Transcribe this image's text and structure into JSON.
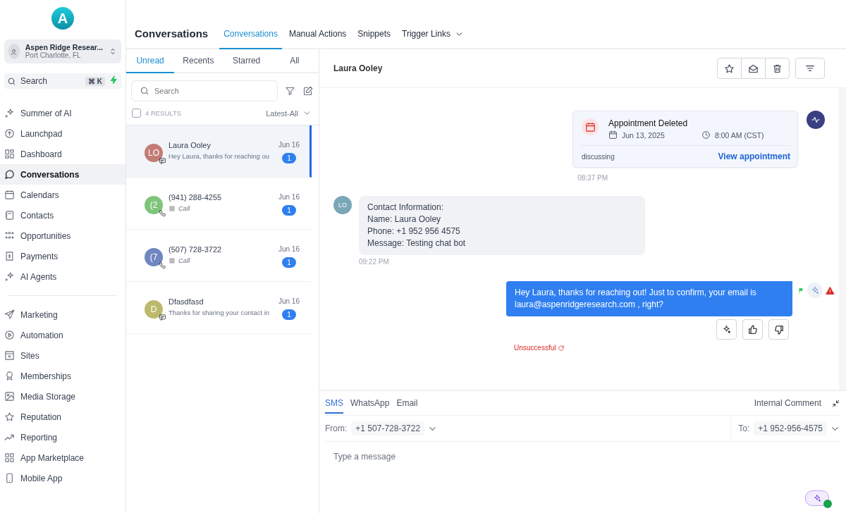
{
  "sidebar": {
    "logo": "A",
    "account": {
      "name": "Aspen Ridge Resear...",
      "location": "Port Charlotte, FL"
    },
    "search": {
      "placeholder": "Search",
      "shortcut": "⌘ K"
    },
    "nav_groups": [
      [
        {
          "label": "Summer of AI",
          "selected": false
        },
        {
          "label": "Launchpad",
          "selected": false
        },
        {
          "label": "Dashboard",
          "selected": false
        },
        {
          "label": "Conversations",
          "selected": true
        },
        {
          "label": "Calendars",
          "selected": false
        },
        {
          "label": "Contacts",
          "selected": false
        },
        {
          "label": "Opportunities",
          "selected": false
        },
        {
          "label": "Payments",
          "selected": false
        },
        {
          "label": "AI Agents",
          "selected": false
        }
      ],
      [
        {
          "label": "Marketing",
          "selected": false
        },
        {
          "label": "Automation",
          "selected": false
        },
        {
          "label": "Sites",
          "selected": false
        },
        {
          "label": "Memberships",
          "selected": false
        },
        {
          "label": "Media Storage",
          "selected": false
        },
        {
          "label": "Reputation",
          "selected": false
        },
        {
          "label": "Reporting",
          "selected": false
        },
        {
          "label": "App Marketplace",
          "selected": false
        },
        {
          "label": "Mobile App",
          "selected": false
        }
      ]
    ]
  },
  "header": {
    "title": "Conversations",
    "tabs": [
      {
        "label": "Conversations",
        "selected": true,
        "dropdown": false
      },
      {
        "label": "Manual Actions",
        "selected": false,
        "dropdown": false
      },
      {
        "label": "Snippets",
        "selected": false,
        "dropdown": false
      },
      {
        "label": "Trigger Links",
        "selected": false,
        "dropdown": true
      }
    ]
  },
  "list": {
    "tabs": [
      {
        "label": "Unread",
        "selected": true
      },
      {
        "label": "Recents",
        "selected": false
      },
      {
        "label": "Starred",
        "selected": false
      },
      {
        "label": "All",
        "selected": false
      }
    ],
    "search": {
      "placeholder": "Search"
    },
    "results": "4 RESULTS",
    "select_all_checked": false,
    "sort": "Latest-All",
    "conversations": [
      {
        "initials": "LO",
        "color": "#c27c74",
        "kind": "sms",
        "name": "Laura Ooley",
        "preview": "Hey Laura, thanks for reaching ou",
        "date": "Jun 16",
        "unread": "1",
        "selected": true
      },
      {
        "initials": "(2",
        "color": "#7fc47a",
        "kind": "call",
        "name": "(941) 288-4255",
        "preview": "Call",
        "date": "Jun 16",
        "unread": "1",
        "selected": false
      },
      {
        "initials": "(7",
        "color": "#6f86c0",
        "kind": "call",
        "name": "(507) 728-3722",
        "preview": "Call",
        "date": "Jun 16",
        "unread": "1",
        "selected": false
      },
      {
        "initials": "D",
        "color": "#bdb96c",
        "kind": "sms",
        "name": "Dfasdfasd",
        "preview": "Thanks for sharing your contact in",
        "date": "Jun 16",
        "unread": "1",
        "selected": false
      }
    ]
  },
  "chat": {
    "contact": "Laura Ooley",
    "messages": [
      {
        "kind": "appointment",
        "title": "Appointment Deleted",
        "date": "Jun 13, 2025",
        "time": "8:00 AM (CST)",
        "note": "discussing",
        "link": "View appointment",
        "timestamp": "08:37 PM"
      },
      {
        "kind": "inbound",
        "avatar": "LO",
        "lines": [
          "Contact Information:",
          "Name: Laura Ooley",
          "Phone: +1 952 956 4575",
          "Message: Testing chat bot"
        ],
        "timestamp": "09:22 PM"
      },
      {
        "kind": "outbound",
        "lines": [
          "Hey Laura, thanks for reaching out! Just to confirm, your email is",
          "laura@aspenridgeresearch.com , right?"
        ],
        "status": "Unsuccessful"
      }
    ]
  },
  "composer": {
    "tabs": [
      {
        "label": "SMS",
        "selected": true
      },
      {
        "label": "WhatsApp",
        "selected": false
      },
      {
        "label": "Email",
        "selected": false
      }
    ],
    "internal": "Internal Comment",
    "from_label": "From:",
    "from": "+1 507-728-3722",
    "to_label": "To:",
    "to": "+1 952-956-4575",
    "placeholder": "Type a message"
  }
}
